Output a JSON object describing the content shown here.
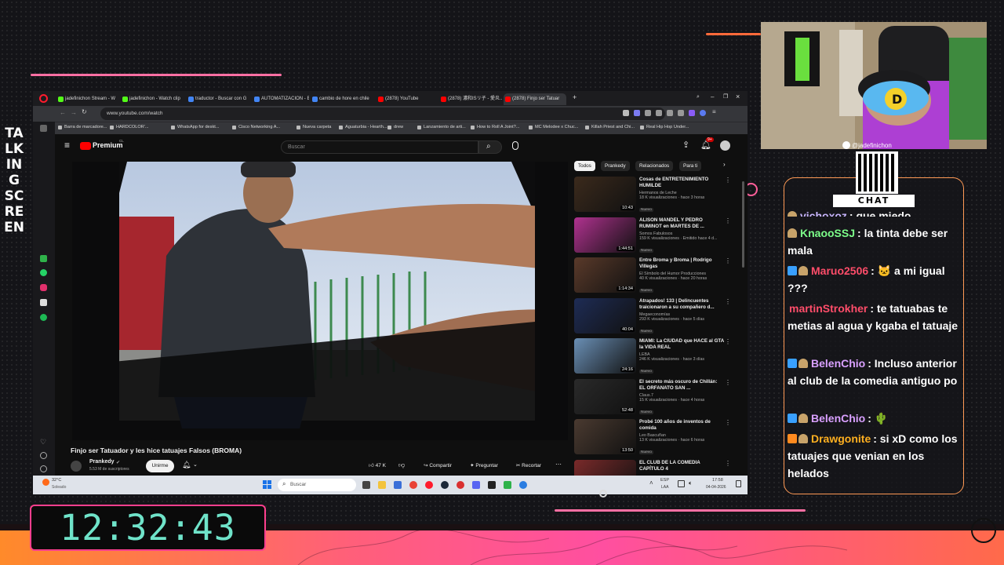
{
  "overlay": {
    "vertical_title": "TALKING SCREEN",
    "clock": "12:32:43",
    "chat_label": "CHAT",
    "streamer_handle": "@jadefinichon",
    "accent": "#ff3f8e",
    "accent2": "#ff8a2a",
    "clock_color": "#6fe3c9"
  },
  "browser": {
    "tabs": [
      {
        "label": "jadefinichon Stream - W",
        "icon": "kick-icon"
      },
      {
        "label": "jadefinichon - Watch clip",
        "icon": "kick-icon"
      },
      {
        "label": "traductor - Buscar con G",
        "icon": "google-icon"
      },
      {
        "label": "AUTOMATIZACION - Bu",
        "icon": "google-icon"
      },
      {
        "label": "cambio de hore en chile",
        "icon": "google-icon"
      },
      {
        "label": "(2878) YouTube",
        "icon": "youtube-icon"
      },
      {
        "label": "(2878) 濃和ISリ子 - 愛炎..",
        "icon": "youtube-icon"
      },
      {
        "label": "(2878) Finjo ser Tatuar",
        "icon": "youtube-icon"
      }
    ],
    "url": "www.youtube.com/watch",
    "bookmarks": [
      "Barra de marcadore...",
      "HARDCOLOR'...",
      "WhatsApp for deskt...",
      "Cisco Networking A...",
      "Nueva carpeta",
      "Aguaturbia - Hearth...",
      "drew",
      "Lanzamiento de arti...",
      "How to Roll A Joint?...",
      "MC Melodee x Chuc...",
      "Killah Priest and Chi...",
      "Real Hip Hop Under..."
    ]
  },
  "youtube": {
    "logo": "Premium",
    "logo_sup": "CL",
    "search_placeholder": "Buscar",
    "notif_count": "9+",
    "video_title": "Finjo ser Tatuador y les hice tatuajes Falsos (BROMA)",
    "channel": "Prankedy",
    "subscribers": "5.53 M de suscriptores",
    "join": "Unirme",
    "likes": "47 K",
    "share": "Compartir",
    "ask": "Preguntar",
    "clip": "Recortar",
    "chips": [
      "Todos",
      "Prankedy",
      "Relacionados",
      "Para ti"
    ],
    "recs": [
      {
        "title": "Cosas de ENTRETENIMIENTO HUMILDE",
        "channel": "Hermanos de Leche",
        "meta": "18 K visualizaciones · hace 3 horas",
        "duration": "10:43",
        "badge": "Nuevo",
        "color": "#3b2a1c"
      },
      {
        "title": "ALISON MANDEL Y PEDRO RUMINOT en MARTES DE ...",
        "channel": "Somos Fabulosos",
        "meta": "159 K visualizaciones · Emitido hace 4 d...",
        "duration": "1:44:51",
        "badge": "Nuevo",
        "color": "#b0328f"
      },
      {
        "title": "Entre Broma y Broma | Rodrigo Villegas",
        "channel": "El Símbolo del Humor Producciones",
        "meta": "40 K visualizaciones · hace 20 horas",
        "duration": "1:14:34",
        "badge": "Nuevo",
        "color": "#5a3a2a"
      },
      {
        "title": "Atrapados! 133 | Delincuentes traicionaron a su compañero d...",
        "channel": "Megaeconomías",
        "meta": "293 K visualizaciones · hace 5 días",
        "duration": "40:04",
        "badge": "Nuevo",
        "color": "#1e2c55"
      },
      {
        "title": "MIAMI: La CIUDAD que HACE al GTA la VIDA REAL",
        "channel": "LEBA",
        "meta": "246 K visualizaciones · hace 3 días",
        "duration": "24:16",
        "badge": "Nuevo",
        "color": "#6a8fb5"
      },
      {
        "title": "El secreto más oscuro de Chillán: EL ORFANATO SAN ...",
        "channel": "Claus.7",
        "meta": "15 K visualizaciones · hace 4 horas",
        "duration": "52:48",
        "badge": "Nuevo",
        "color": "#2a2a2a"
      },
      {
        "title": "Probé 100 años de inventos de comida",
        "channel": "Leo Bascuñan",
        "meta": "13 K visualizaciones · hace 6 horas",
        "duration": "13:50",
        "badge": "Nuevo",
        "color": "#4a3a30"
      },
      {
        "title": "EL CLUB DE LA COMEDIA CAPÍTULO 4",
        "channel": "",
        "meta": "",
        "duration": "",
        "badge": "",
        "color": "#7a2a2a"
      }
    ]
  },
  "taskbar": {
    "weather_temp": "32°C",
    "weather_desc": "Soleado",
    "search_placeholder": "Buscar",
    "lang": "ESP",
    "lang2": "LAA",
    "time": "17:58",
    "date": "04-04-2026"
  },
  "chat": {
    "messages": [
      {
        "user": "vichoxoz",
        "text": ": que miedo",
        "color": "#c9b6ff",
        "badges": [
          "helmet"
        ]
      },
      {
        "user": "KnaooSSJ",
        "text": ": la tinta debe ser mala",
        "color": "#7dff8a",
        "badges": [
          "helmet"
        ]
      },
      {
        "user": "Maruo2506",
        "text": ": 🐱 a mi igual ???",
        "color": "#ff4d6a",
        "badges": [
          "cube",
          "helmet"
        ]
      },
      {
        "user": "martinStrokher",
        "text": ": te tatuabas te metias al agua y kgaba el tatuaje",
        "color": "#ff4d6a",
        "badges": []
      },
      {
        "user": "BelenChio",
        "text": ": Incluso anterior al club de la comedia antiguo po",
        "color": "#d9a0ff",
        "badges": [
          "cube",
          "helmet"
        ]
      },
      {
        "user": "BelenChio",
        "text": ": 🌵",
        "color": "#d9a0ff",
        "badges": [
          "cube",
          "helmet"
        ]
      },
      {
        "user": "Drawgonite",
        "text": ": si xD como los tatuajes que venian en los helados",
        "color": "#ffb020",
        "badges": [
          "cube2",
          "helmet"
        ]
      }
    ]
  }
}
